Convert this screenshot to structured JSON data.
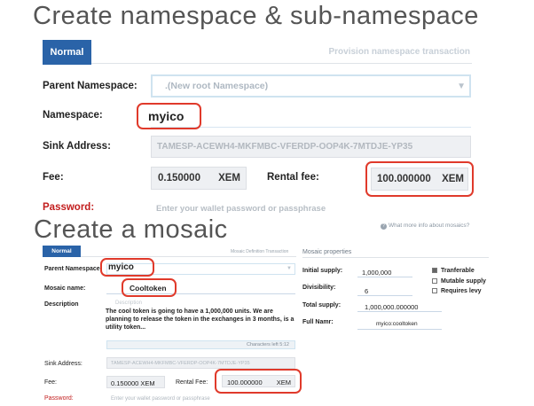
{
  "section1": {
    "title": "Create namespace & sub-namespace",
    "tab_label": "Normal",
    "header_right": "Provision namespace transaction",
    "parent_label": "Parent Namespace:",
    "parent_value": ".(New root Namespace)",
    "namespace_label": "Namespace:",
    "namespace_value": "myico",
    "sink_label": "Sink Address:",
    "sink_value": "TAMESP-ACEWH4-MKFMBC-VFERDP-OOP4K-7MTDJE-YP35",
    "fee_label": "Fee:",
    "fee_value": "0.150000",
    "fee_unit": "XEM",
    "rental_label": "Rental fee:",
    "rental_value": "100.000000",
    "rental_unit": "XEM",
    "password_label": "Password:",
    "password_placeholder": "Enter your wallet password or passphrase"
  },
  "section2": {
    "title": "Create a mosaic",
    "help_link": "What more info about mosaics?",
    "tab_label": "Normal",
    "header_mid": "Mosaic Definition Transaction",
    "header_right": "Mosaic properties",
    "parent_label": "Parent Namespace:",
    "parent_value": "myico",
    "mosaic_label": "Mosaic name:",
    "mosaic_value": "Cooltoken",
    "desc_label": "Description",
    "desc_placeholder": "Description",
    "desc_text": "The cool token is going to have a 1,000,000 units. We are planning to release the token in the exchanges in 3 months, is a utility token...",
    "chars_left": "Characters left 5:12",
    "initial_supply_label": "Initial supply:",
    "initial_supply_value": "1,000,000",
    "divisibility_label": "Divisibility:",
    "divisibility_value": "6",
    "total_supply_label": "Total supply:",
    "total_supply_value": "1,000,000.000000",
    "full_name_label": "Full Namr:",
    "full_name_value": "myico:cooltoken",
    "checkbox_transferable": "Tranferable",
    "checkbox_mutable": "Mutable supply",
    "checkbox_levy": "Requires levy",
    "sink_label": "Sink Address:",
    "sink_value": "TAMESP-ACEWH4-MKFMBC-VFERDP-OOP4K-7MTDJE-YP35",
    "fee_label": "Fee:",
    "fee_value": "0.150000 XEM",
    "rental_label": "Rental Fee:",
    "rental_value": "100.000000",
    "rental_unit": "XEM",
    "password_label": "Password:",
    "password_placeholder": "Enter your wallet password or passphrase"
  },
  "colors": {
    "accent": "#2a63a8",
    "highlight": "#e03a2b",
    "required": "#c21d1d"
  }
}
